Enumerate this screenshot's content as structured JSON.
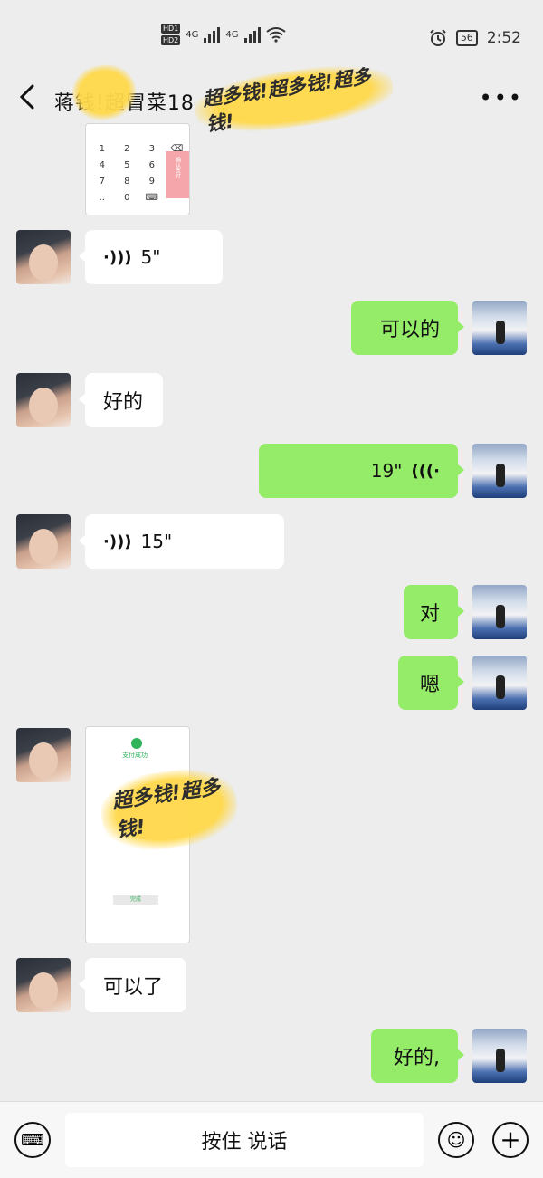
{
  "status_bar": {
    "hd1": "HD1",
    "hd2": "HD2",
    "net1": "4G",
    "net2": "4G",
    "battery": "56",
    "time": "2:52",
    "icons": [
      "signal-icon",
      "wifi-icon",
      "alarm-icon",
      "battery-icon"
    ]
  },
  "header": {
    "title": "蒋钱!超冒菜18",
    "watermark": "超多钱!超多钱!超多钱!"
  },
  "messages": [
    {
      "side": "left",
      "type": "image",
      "keys": [
        "1",
        "2",
        "3",
        "⌫",
        "4",
        "5",
        "6",
        "",
        "7",
        "8",
        "9",
        "",
        "..",
        "0",
        "⌨",
        ""
      ],
      "pay_label": "确认支付"
    },
    {
      "side": "left",
      "type": "voice",
      "duration": "5\""
    },
    {
      "side": "right",
      "type": "text",
      "text": "可以的"
    },
    {
      "side": "left",
      "type": "text",
      "text": "好的"
    },
    {
      "side": "right",
      "type": "voice",
      "duration": "19\""
    },
    {
      "side": "left",
      "type": "voice",
      "duration": "15\""
    },
    {
      "side": "right",
      "type": "text",
      "text": "对"
    },
    {
      "side": "right",
      "type": "text",
      "text": "嗯"
    },
    {
      "side": "left",
      "type": "image",
      "caption": "支付成功",
      "button": "完成",
      "watermark": "超多钱!超多钱!"
    },
    {
      "side": "left",
      "type": "text",
      "text": "可以了"
    },
    {
      "side": "right",
      "type": "text",
      "text": "好的,"
    }
  ],
  "input_bar": {
    "hold_to_talk": "按住 说话",
    "keyboard_icon": "keyboard-icon",
    "emoji_icon": "emoji-icon",
    "plus_icon": "plus-icon"
  }
}
